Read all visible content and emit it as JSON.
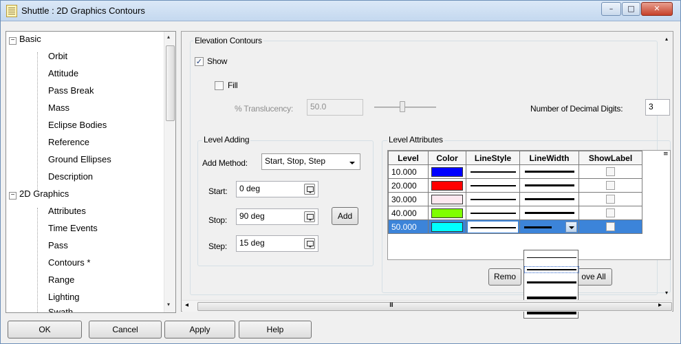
{
  "window": {
    "title": "Shuttle : 2D Graphics Contours",
    "minimize_glyph": "–",
    "maximize_glyph": "□",
    "close_glyph": "✕"
  },
  "tree": {
    "expanded_glyph": "−",
    "items": [
      {
        "label": "Basic",
        "level": 0
      },
      {
        "label": "Orbit",
        "level": 1
      },
      {
        "label": "Attitude",
        "level": 1
      },
      {
        "label": "Pass Break",
        "level": 1
      },
      {
        "label": "Mass",
        "level": 1
      },
      {
        "label": "Eclipse Bodies",
        "level": 1
      },
      {
        "label": "Reference",
        "level": 1
      },
      {
        "label": "Ground Ellipses",
        "level": 1
      },
      {
        "label": "Description",
        "level": 1
      },
      {
        "label": "2D Graphics",
        "level": 0
      },
      {
        "label": "Attributes",
        "level": 1
      },
      {
        "label": "Time Events",
        "level": 1
      },
      {
        "label": "Pass",
        "level": 1
      },
      {
        "label": "Contours *",
        "level": 1
      },
      {
        "label": "Range",
        "level": 1
      },
      {
        "label": "Lighting",
        "level": 1
      },
      {
        "label": "Swath",
        "level": 1
      }
    ]
  },
  "elevation": {
    "group_title": "Elevation Contours",
    "show_label": "Show",
    "show_checked": true,
    "fill_label": "Fill",
    "fill_checked": false,
    "translucency_label": "% Translucency:",
    "translucency_value": "50.0",
    "translucency_slider_fraction": 0.5,
    "decimal_label": "Number of Decimal Digits:",
    "decimal_value": "3",
    "check_glyph": "✓"
  },
  "level_adding": {
    "group_title": "Level Adding",
    "method_label": "Add Method:",
    "method_value": "Start, Stop, Step",
    "start_label": "Start:",
    "start_value": "0 deg",
    "stop_label": "Stop:",
    "stop_value": "90 deg",
    "step_label": "Step:",
    "step_value": "15 deg",
    "add_button": "Add"
  },
  "level_attributes": {
    "group_title": "Level Attributes",
    "columns": [
      "Level",
      "Color",
      "LineStyle",
      "LineWidth",
      "ShowLabel"
    ],
    "rows": [
      {
        "level": "10.000",
        "color": "#0000ff",
        "line_width": 2,
        "show_label": false
      },
      {
        "level": "20.000",
        "color": "#ff0000",
        "line_width": 2,
        "show_label": false
      },
      {
        "level": "30.000",
        "color": "#fde8ef",
        "line_width": 2,
        "show_label": false
      },
      {
        "level": "40.000",
        "color": "#7fff00",
        "line_width": 2,
        "show_label": false
      },
      {
        "level": "50.000",
        "color": "#00ffff",
        "line_width": 2,
        "show_label": false,
        "selected": true
      }
    ],
    "remove_button": "Remo",
    "remove_all_button": "ove All",
    "line_width_options": [
      1,
      2,
      3,
      4,
      5
    ]
  },
  "buttons": {
    "ok": "OK",
    "cancel": "Cancel",
    "apply": "Apply",
    "help": "Help"
  },
  "scroll": {
    "left_arrow": "◂",
    "right_arrow": "▸",
    "up_arrow": "▴",
    "down_arrow": "▾",
    "grip": "III",
    "side_grip": "≡"
  }
}
